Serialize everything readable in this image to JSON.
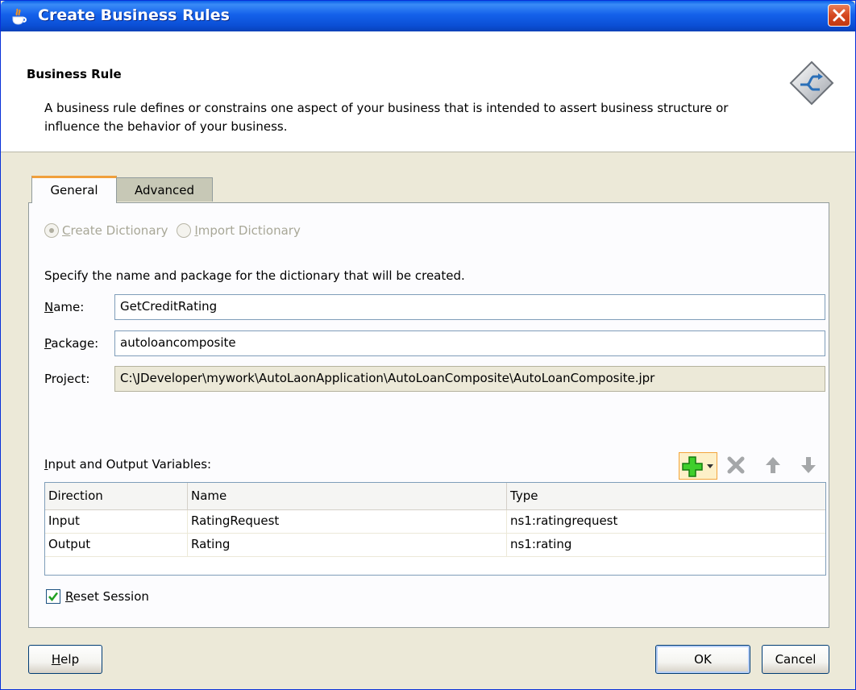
{
  "window": {
    "title": "Create Business Rules"
  },
  "banner": {
    "title": "Business Rule",
    "description": "A business rule defines or constrains one aspect of your business that is intended to assert business structure or influence the behavior of your business."
  },
  "tabs": [
    {
      "label": "General",
      "active": true
    },
    {
      "label": "Advanced",
      "active": false
    }
  ],
  "radios": {
    "create_label_first": "C",
    "create_label_rest": "reate Dictionary",
    "import_label_first": "I",
    "import_label_rest": "mport Dictionary",
    "selected": "Create Dictionary"
  },
  "form": {
    "instruction": "Specify the name and package for the dictionary that will be created.",
    "name_label_first": "N",
    "name_label_rest": "ame:",
    "name_value": "GetCreditRating",
    "package_label_first": "P",
    "package_label_rest": "ackage:",
    "package_value": "autoloancomposite",
    "project_label": "Project:",
    "project_value": "C:\\JDeveloper\\mywork\\AutoLaonApplication\\AutoLoanComposite\\AutoLoanComposite.jpr"
  },
  "variables": {
    "label_first": "I",
    "label_rest": "nput and Output Variables:",
    "columns": [
      "Direction",
      "Name",
      "Type"
    ],
    "rows": [
      [
        "Input",
        "RatingRequest",
        "ns1:ratingrequest"
      ],
      [
        "Output",
        "Rating",
        "ns1:rating"
      ]
    ]
  },
  "reset_session": {
    "label_first": "R",
    "label_rest": "eset Session",
    "checked": true
  },
  "buttons": {
    "help_first": "H",
    "help_rest": "elp",
    "ok": "OK",
    "cancel": "Cancel"
  },
  "colors": {
    "titlebar": "#0b4fd6",
    "dialog_bg": "#ece9d8",
    "add_highlight": "#f3a53c"
  }
}
